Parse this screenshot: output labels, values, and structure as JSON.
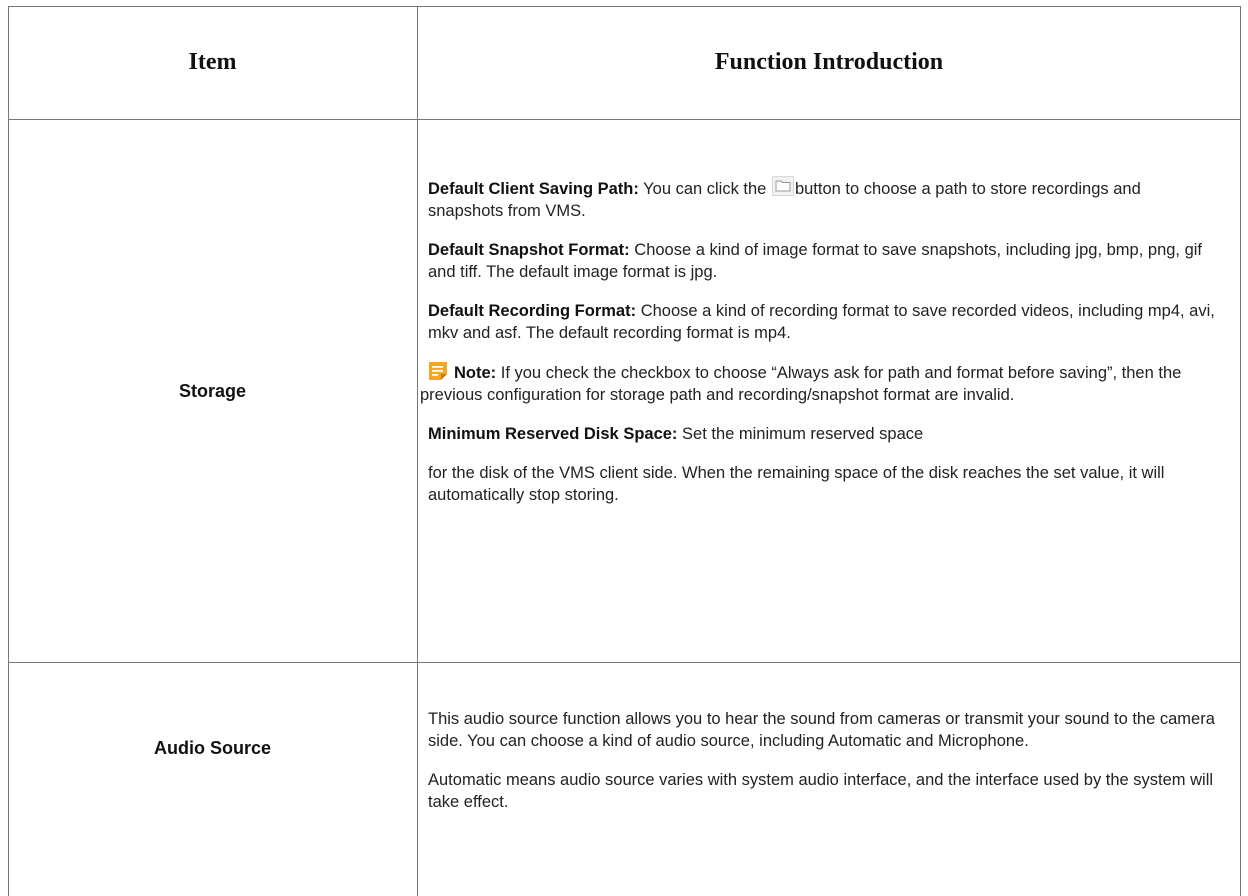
{
  "headers": {
    "item": "Item",
    "function": "Function Introduction"
  },
  "rows": {
    "storage": {
      "label": "Storage",
      "saving_path_label": "Default Client Saving Path:",
      "saving_path_text_a": " You can click the ",
      "saving_path_text_b": "button to choose a path to store recordings and snapshots from VMS.",
      "snapshot_label": "Default Snapshot Format:",
      "snapshot_text": " Choose a kind of image format to save snapshots, including jpg, bmp, png, gif and tiff. The default image format is jpg.",
      "recording_label": "Default Recording Format:",
      "recording_text": " Choose a kind of recording format to save recorded videos, including mp4, avi, mkv and asf. The default recording format is mp4.",
      "note_label": "Note:",
      "note_text": "  If you check the checkbox to choose “Always ask for path and format before saving”, then the previous configuration for storage path and recording/snapshot format are invalid.",
      "disk_label": "Minimum Reserved Disk Space:",
      "disk_text": " Set the minimum reserved space",
      "disk_text_2": "for the disk of the VMS client side. When the remaining space of the disk reaches the set value, it will automatically stop storing."
    },
    "audio": {
      "label": "Audio Source",
      "para1": "This audio source function allows you to hear the sound from cameras or transmit your sound to the camera side. You can choose a kind of audio source, including Automatic and Microphone.",
      "para2": "Automatic means audio source varies with system audio interface, and the interface used by the system will take effect."
    }
  },
  "icons": {
    "folder": "folder-icon",
    "note": "note-icon"
  },
  "colors": {
    "border": "#777777",
    "note_accent": "#f5a623"
  }
}
